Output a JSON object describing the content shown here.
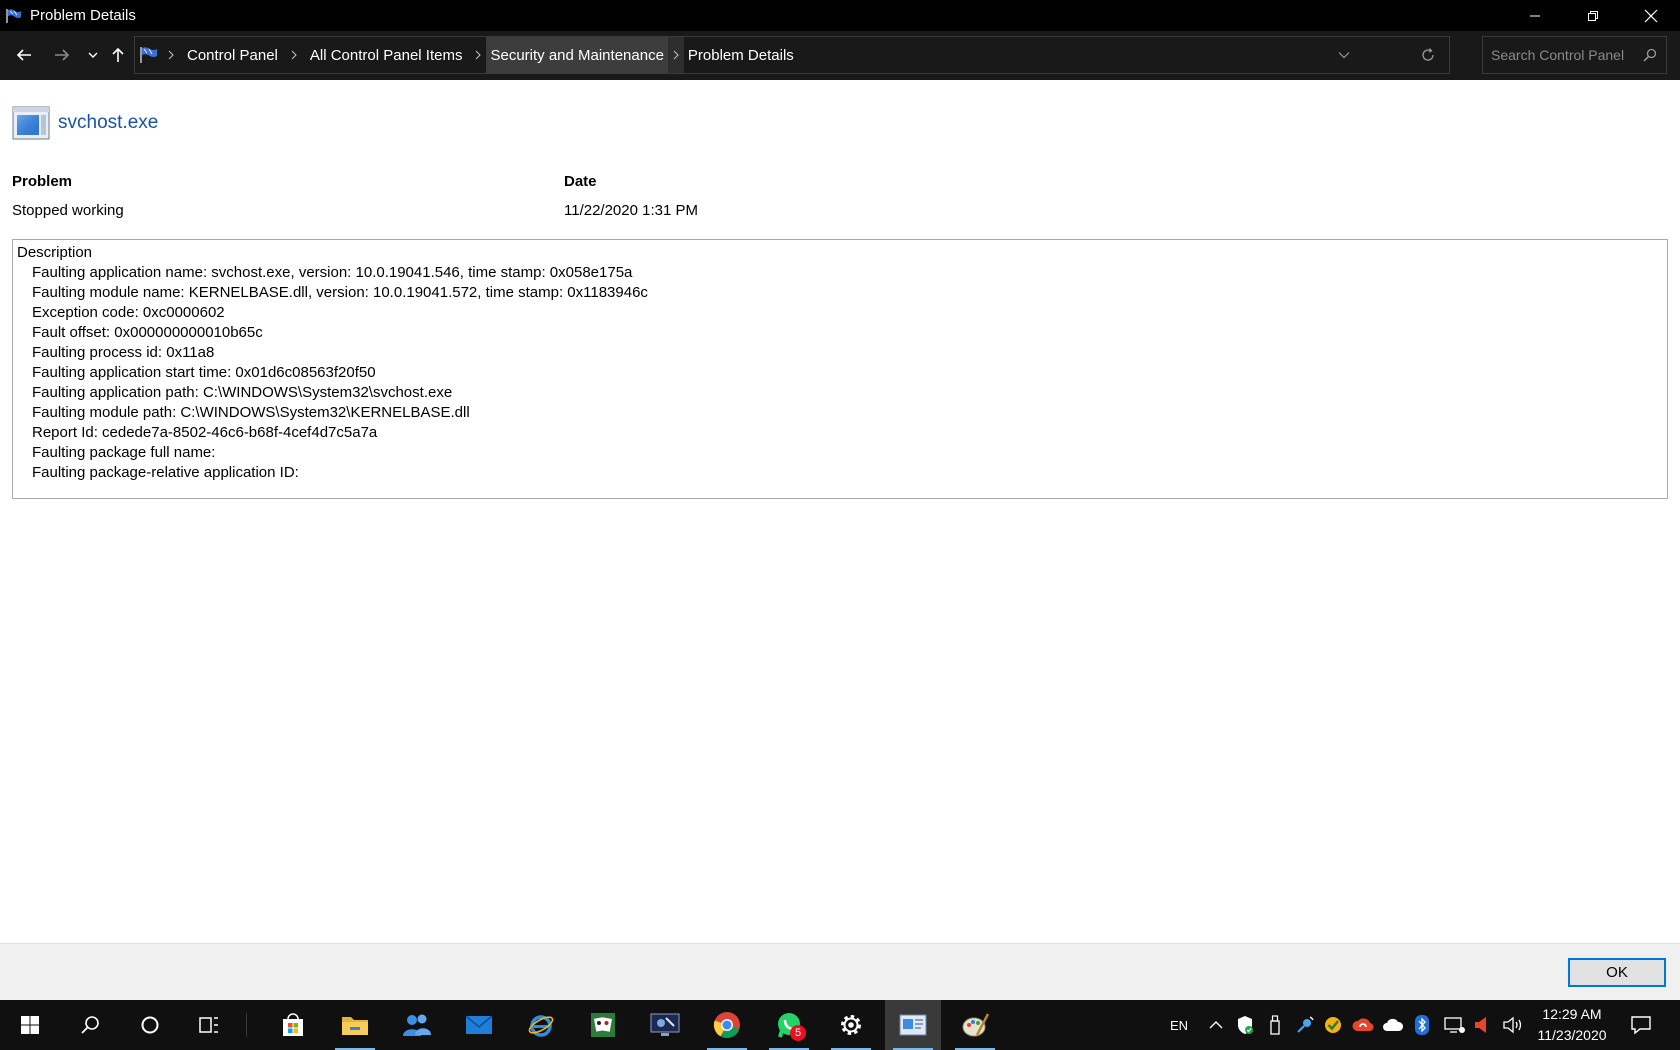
{
  "window": {
    "title": "Problem Details",
    "minimize_icon": "minimize-icon",
    "restore_icon": "restore-icon",
    "close_icon": "close-icon"
  },
  "breadcrumbs": [
    {
      "label": "Control Panel"
    },
    {
      "label": "All Control Panel Items"
    },
    {
      "label": "Security and Maintenance"
    },
    {
      "label": "Problem Details"
    }
  ],
  "search": {
    "placeholder": "Search Control Panel"
  },
  "app": {
    "name": "svchost.exe"
  },
  "problem": {
    "header": "Problem",
    "value": "Stopped working"
  },
  "date": {
    "header": "Date",
    "value": "11/22/2020 1:31 PM"
  },
  "description": {
    "title": "Description",
    "lines": [
      "Faulting application name: svchost.exe, version: 10.0.19041.546, time stamp: 0x058e175a",
      "Faulting module name: KERNELBASE.dll, version: 10.0.19041.572, time stamp: 0x1183946c",
      "Exception code: 0xc0000602",
      "Fault offset: 0x000000000010b65c",
      "Faulting process id: 0x11a8",
      "Faulting application start time: 0x01d6c08563f20f50",
      "Faulting application path: C:\\WINDOWS\\System32\\svchost.exe",
      "Faulting module path: C:\\WINDOWS\\System32\\KERNELBASE.dll",
      "Report Id: cedede7a-8502-46c6-b68f-4cef4d7c5a7a",
      "Faulting package full name: ",
      "Faulting package-relative application ID: "
    ]
  },
  "footer": {
    "ok_label": "OK"
  },
  "taskbar": {
    "language": "EN",
    "time": "12:29 AM",
    "date": "11/23/2020",
    "whatsapp_badge": "5"
  },
  "colors": {
    "accent": "#0078d7",
    "link": "#1a52a8"
  }
}
